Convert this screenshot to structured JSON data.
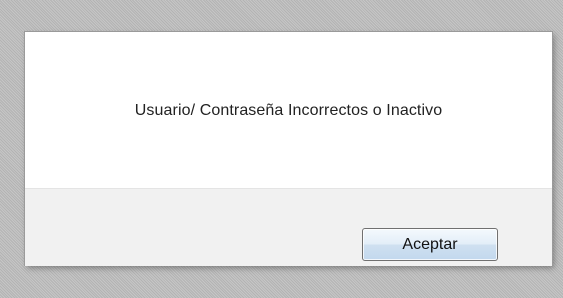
{
  "dialog": {
    "message": "Usuario/ Contraseña Incorrectos o Inactivo",
    "accept_label": "Aceptar"
  },
  "colors": {
    "overlay": "#bdbdbd",
    "dialog_background": "#ffffff",
    "footer_background": "#f1f1f1",
    "button_top": "#f4f9fd",
    "button_bottom": "#c2d8ee",
    "button_border": "#707070"
  }
}
